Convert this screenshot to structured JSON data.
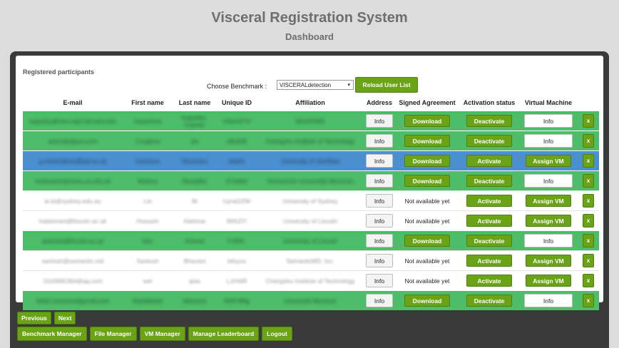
{
  "header": {
    "title": "Visceral Registration System",
    "subtitle": "Dashboard"
  },
  "panel": {
    "title": "Registered participants",
    "benchmark_label": "Choose Benchmark :",
    "benchmark_selected": "VISCERALdetection",
    "reload_button": "Reload User List"
  },
  "columns": [
    "E-mail",
    "First name",
    "Last name",
    "Unique ID",
    "Affiliation",
    "Address",
    "Signed Agreement",
    "Activation status",
    "Virtual Machine",
    ""
  ],
  "rows": [
    {
      "style": "green",
      "email": "kalpathy@nmr.mgh.harvard.edu",
      "first": "Jayashree",
      "last": "Kalpathy-Cramer",
      "uid": "ViSent27V",
      "affil": "MGH/HMS",
      "address": "Info",
      "agreement": "Download",
      "activation": "Deactivate",
      "vm": "Info",
      "delete": "x"
    },
    {
      "style": "green",
      "email": "wech@aliyun.com",
      "first": "Conghua",
      "last": "xie",
      "uid": "a8u0rB",
      "affil": "Changshu Institute of Technology",
      "address": "Info",
      "agreement": "Download",
      "activation": "Deactivate",
      "vm": "Info",
      "delete": "x"
    },
    {
      "style": "blue",
      "email": "g.mimmi@sheffield.ac.uk",
      "first": "Gianluca",
      "last": "Dimartino",
      "uid": "ikkbM",
      "affil": "University of Sheffield",
      "address": "Info",
      "agreement": "Download",
      "activation": "Activate",
      "vm": "Assign VM",
      "delete": "x"
    },
    {
      "style": "green",
      "email": "markuswn@cmun.ce.nitu.ck",
      "first": "Markus",
      "last": "Rampfler",
      "uid": "E7adfaf",
      "affil": "Technische Universität München",
      "address": "Info",
      "agreement": "Download",
      "activation": "Deactivate",
      "vm": "Info",
      "delete": "x"
    },
    {
      "style": "white",
      "email": "le.bi@sydney.edu.au",
      "first": "Lei",
      "last": "Bi",
      "uid": "Uyrwi2ZW",
      "affil": "University of Sydney",
      "address": "Info",
      "agreement": "Not available yet",
      "activation": "Activate",
      "vm": "Assign VM",
      "delete": "x"
    },
    {
      "style": "white",
      "email": "halahmani@lincoln.ac.uk",
      "first": "Hussam",
      "last": "Alahmar",
      "uid": "9IfAZIY",
      "affil": "University of Lincoln",
      "address": "Info",
      "agreement": "Not available yet",
      "activation": "Activate",
      "vm": "Assign VM",
      "delete": "x"
    },
    {
      "style": "green",
      "email": "aahmed@lincoln.ac.uk",
      "first": "Amr",
      "last": "Ahmed",
      "uid": "FJ5RL",
      "affil": "University of Lincoln",
      "address": "Info",
      "agreement": "Download",
      "activation": "Deactivate",
      "vm": "Info",
      "delete": "x"
    },
    {
      "style": "white",
      "email": "santosh@semantic.md",
      "first": "Santosh",
      "last": "Bhavani",
      "uid": "bthyuo",
      "affil": "SemanticMD, Inc.",
      "address": "Info",
      "agreement": "Not available yet",
      "activation": "Activate",
      "vm": "Assign VM",
      "delete": "x"
    },
    {
      "style": "white",
      "email": "1010965364@qq.com",
      "first": "wei",
      "last": "qiao",
      "uid": "LJrHdR",
      "affil": "Changshu Institute of Technology",
      "address": "Info",
      "agreement": "Not available yet",
      "activation": "Activate",
      "vm": "Assign VM",
      "delete": "x"
    },
    {
      "style": "green",
      "email": "fellah.meriame@gmail.com",
      "first": "Abdelfettah",
      "last": "Meriame",
      "uid": "9WFW8g",
      "affil": "Université Mentouri",
      "address": "Info",
      "agreement": "Download",
      "activation": "Deactivate",
      "vm": "Info",
      "delete": "x"
    }
  ],
  "pager": {
    "previous": "Previous",
    "next": "Next"
  },
  "managers": {
    "benchmark": "Benchmark Manager",
    "file": "File Manager",
    "vm": "VM Manager",
    "leaderboard": "Manage Leaderboard",
    "logout": "Logout"
  },
  "colors": {
    "green_row": "#4dbd6a",
    "blue_row": "#4a8fcf",
    "button_green": "#6aa316"
  }
}
